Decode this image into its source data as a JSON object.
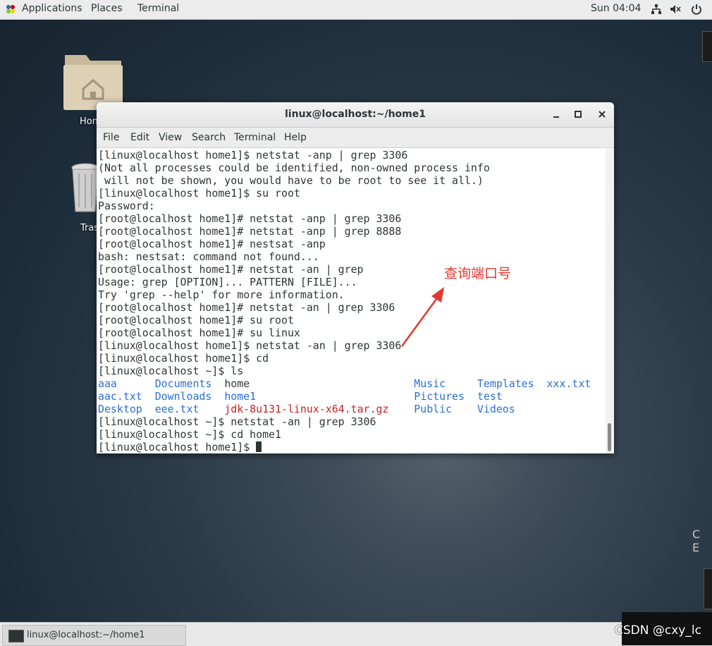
{
  "topbar": {
    "applications": "Applications",
    "places": "Places",
    "terminal": "Terminal",
    "clock": "Sun 04:04",
    "icons": [
      "network-icon",
      "volume-icon",
      "power-icon"
    ]
  },
  "desktop": {
    "home_label": "Hom",
    "trash_label": "Tras",
    "partial_text": "C E"
  },
  "window": {
    "title": "linux@localhost:~/home1",
    "menu": [
      "File",
      "Edit",
      "View",
      "Search",
      "Terminal",
      "Help"
    ],
    "lines": [
      "[linux@localhost home1]$ netstat -anp | grep 3306",
      "(Not all processes could be identified, non-owned process info",
      " will not be shown, you would have to be root to see it all.)",
      "[linux@localhost home1]$ su root",
      "Password:",
      "[root@localhost home1]# netstat -anp | grep 3306",
      "[root@localhost home1]# netstat -anp | grep 8888",
      "[root@localhost home1]# nestsat -anp",
      "bash: nestsat: command not found...",
      "[root@localhost home1]# netstat -an | grep",
      "Usage: grep [OPTION]... PATTERN [FILE]...",
      "Try 'grep --help' for more information.",
      "[root@localhost home1]# netstat -an | grep 3306",
      "[root@localhost home1]# su root",
      "[root@localhost home1]# su linux",
      "[linux@localhost home1]$ netstat -an | grep 3306",
      "[linux@localhost home1]$ cd",
      "[linux@localhost ~]$ ls"
    ],
    "ls_rows": [
      [
        {
          "t": "aaa      ",
          "c": "blue"
        },
        {
          "t": "Documents  ",
          "c": "blue"
        },
        {
          "t": "home                          ",
          "c": ""
        },
        {
          "t": "Music     ",
          "c": "blue"
        },
        {
          "t": "Templates  ",
          "c": "blue"
        },
        {
          "t": "xxx.txt",
          "c": "blue"
        }
      ],
      [
        {
          "t": "aac.txt  ",
          "c": "blue"
        },
        {
          "t": "Downloads  ",
          "c": "blue"
        },
        {
          "t": "home1                         ",
          "c": "blue"
        },
        {
          "t": "Pictures  ",
          "c": "blue"
        },
        {
          "t": "test",
          "c": "blue"
        }
      ],
      [
        {
          "t": "Desktop  ",
          "c": "blue"
        },
        {
          "t": "eee.txt    ",
          "c": "blue"
        },
        {
          "t": "jdk-8u131-linux-x64.tar.gz    ",
          "c": "red"
        },
        {
          "t": "Public    ",
          "c": "blue"
        },
        {
          "t": "Videos",
          "c": "blue"
        }
      ]
    ],
    "after_lines": [
      "[linux@localhost ~]$ netstat -an | grep 3306",
      "[linux@localhost ~]$ cd home1",
      "[linux@localhost home1]$ "
    ]
  },
  "annotation": {
    "text": "查询端口号",
    "color": "#e8372c"
  },
  "taskbar": {
    "item_label": "linux@localhost:~/home1"
  },
  "watermark": "CSDN @cxy_lc"
}
